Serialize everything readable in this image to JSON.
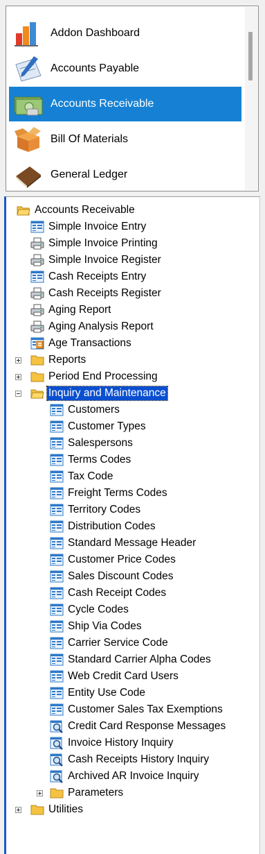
{
  "modules": [
    {
      "label": "Addon Dashboard",
      "icon": "dashboard-chart-icon",
      "selected": false
    },
    {
      "label": "Accounts Payable",
      "icon": "pen-paper-icon",
      "selected": false
    },
    {
      "label": "Accounts Receivable",
      "icon": "money-stack-icon",
      "selected": true
    },
    {
      "label": "Bill Of Materials",
      "icon": "box-icon",
      "selected": false
    },
    {
      "label": "General Ledger",
      "icon": "ledger-book-icon",
      "selected": false
    }
  ],
  "tree": {
    "root": "Accounts Receivable",
    "items": [
      {
        "label": "Simple Invoice Entry",
        "icon": "form-icon"
      },
      {
        "label": "Simple Invoice Printing",
        "icon": "printer-icon"
      },
      {
        "label": "Simple Invoice Register",
        "icon": "printer-icon"
      },
      {
        "label": "Cash Receipts Entry",
        "icon": "form-icon"
      },
      {
        "label": "Cash Receipts Register",
        "icon": "printer-icon"
      },
      {
        "label": "Aging Report",
        "icon": "printer-icon"
      },
      {
        "label": "Aging Analysis Report",
        "icon": "printer-icon"
      },
      {
        "label": "Age Transactions",
        "icon": "process-icon"
      }
    ],
    "folders": {
      "reports": "Reports",
      "period_end": "Period End Processing",
      "inquiry": "Inquiry and Maintenance",
      "parameters": "Parameters",
      "utilities": "Utilities"
    },
    "inquiry_items": [
      {
        "label": "Customers",
        "icon": "form-icon"
      },
      {
        "label": "Customer Types",
        "icon": "form-icon"
      },
      {
        "label": "Salespersons",
        "icon": "form-icon"
      },
      {
        "label": "Terms Codes",
        "icon": "form-icon"
      },
      {
        "label": "Tax Code",
        "icon": "form-icon"
      },
      {
        "label": "Freight Terms Codes",
        "icon": "form-icon"
      },
      {
        "label": "Territory Codes",
        "icon": "form-icon"
      },
      {
        "label": "Distribution Codes",
        "icon": "form-icon"
      },
      {
        "label": "Standard Message Header",
        "icon": "form-icon"
      },
      {
        "label": "Customer Price Codes",
        "icon": "form-icon"
      },
      {
        "label": "Sales Discount Codes",
        "icon": "form-icon"
      },
      {
        "label": "Cash Receipt Codes",
        "icon": "form-icon"
      },
      {
        "label": "Cycle Codes",
        "icon": "form-icon"
      },
      {
        "label": "Ship Via Codes",
        "icon": "form-icon"
      },
      {
        "label": "Carrier Service Code",
        "icon": "form-icon"
      },
      {
        "label": "Standard Carrier Alpha Codes",
        "icon": "form-icon"
      },
      {
        "label": "Web Credit Card Users",
        "icon": "form-icon"
      },
      {
        "label": "Entity Use Code",
        "icon": "form-icon"
      },
      {
        "label": "Customer Sales Tax Exemptions",
        "icon": "form-icon"
      },
      {
        "label": "Credit Card Response Messages",
        "icon": "inquiry-icon"
      },
      {
        "label": "Invoice History Inquiry",
        "icon": "inquiry-icon"
      },
      {
        "label": "Cash Receipts History Inquiry",
        "icon": "inquiry-icon"
      },
      {
        "label": "Archived AR Invoice Inquiry",
        "icon": "inquiry-icon"
      }
    ]
  },
  "colors": {
    "selection": "#1681d4",
    "tree_selection": "#0a4fd0",
    "folder": "#f5c342",
    "form_icon": "#2e78c7"
  }
}
